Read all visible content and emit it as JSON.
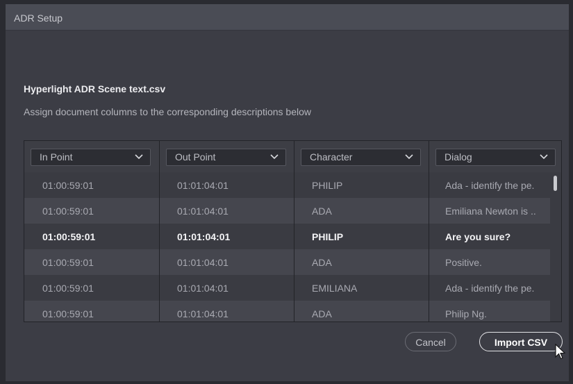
{
  "window": {
    "title": "ADR Setup"
  },
  "file": {
    "name": "Hyperlight ADR Scene text.csv"
  },
  "instructions": "Assign document columns to the corresponding descriptions below",
  "columns": [
    {
      "label": "In Point"
    },
    {
      "label": "Out Point"
    },
    {
      "label": "Character"
    },
    {
      "label": "Dialog"
    }
  ],
  "rows": [
    {
      "in": "01:00:59:01",
      "out": "01:01:04:01",
      "character": "PHILIP",
      "dialog": "Ada - identify the pe."
    },
    {
      "in": "01:00:59:01",
      "out": "01:01:04:01",
      "character": "ADA",
      "dialog": "Emiliana Newton is .."
    },
    {
      "in": "01:00:59:01",
      "out": "01:01:04:01",
      "character": "PHILIP",
      "dialog": "Are you sure?"
    },
    {
      "in": "01:00:59:01",
      "out": "01:01:04:01",
      "character": "ADA",
      "dialog": "Positive."
    },
    {
      "in": "01:00:59:01",
      "out": "01:01:04:01",
      "character": "EMILIANA",
      "dialog": "Ada - identify the pe."
    },
    {
      "in": "01:00:59:01",
      "out": "01:01:04:01",
      "character": "ADA",
      "dialog": "Philip Ng."
    }
  ],
  "selected_row": 2,
  "buttons": {
    "cancel": "Cancel",
    "import": "Import CSV"
  },
  "icons": {
    "dropdown": "chevron-down-icon",
    "pointer": "mouse-cursor-icon"
  },
  "colors": {
    "background": "#3c3d45",
    "titlebar": "#4a4c55",
    "text": "#ececef"
  }
}
